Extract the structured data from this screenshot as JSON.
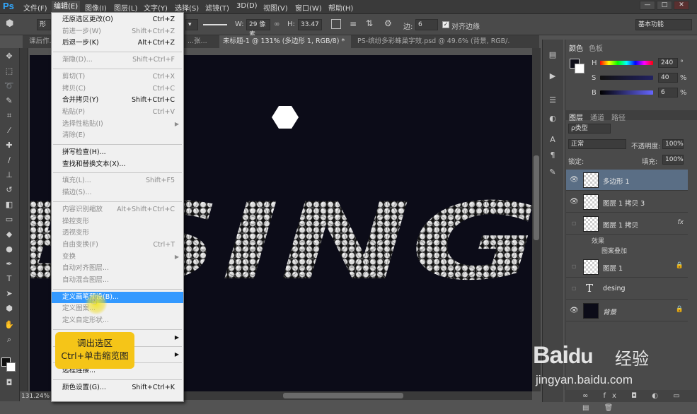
{
  "app": {
    "logo": "Ps"
  },
  "menubar": [
    "文件(F)",
    "编辑(E)",
    "图像(I)",
    "图层(L)",
    "文字(Y)",
    "选择(S)",
    "滤镜(T)",
    "3D(D)",
    "视图(V)",
    "窗口(W)",
    "帮助(H)"
  ],
  "window_buttons": [
    "—",
    "□",
    "✕"
  ],
  "options": {
    "preset": "形",
    "w_label": "W:",
    "w_value": "29 像素",
    "h_label": "H:",
    "h_value": "33.47",
    "sides_label": "边:",
    "sides_value": "6",
    "align_edges": "对齐边缘",
    "workspace": "基本功能"
  },
  "doc_tabs": [
    "课后作...",
    "...张...",
    "未标题-1 @ 131% (多边形 1, RGB/8) *",
    "PS-缤纷多彩蛛巢字效.psd @ 49.6% (背景, RGB/..."
  ],
  "status": {
    "zoom": "131.24%"
  },
  "canvas_text": "ESING",
  "edit_menu": [
    {
      "label": "还原选区更改(O)",
      "shortcut": "Ctrl+Z",
      "disabled": false
    },
    {
      "label": "前进一步(W)",
      "shortcut": "Shift+Ctrl+Z",
      "disabled": true
    },
    {
      "label": "后退一步(K)",
      "shortcut": "Alt+Ctrl+Z",
      "disabled": false
    },
    {
      "sep": true
    },
    {
      "label": "渐隐(D)...",
      "shortcut": "Shift+Ctrl+F",
      "disabled": true
    },
    {
      "sep": true
    },
    {
      "label": "剪切(T)",
      "shortcut": "Ctrl+X",
      "disabled": true
    },
    {
      "label": "拷贝(C)",
      "shortcut": "Ctrl+C",
      "disabled": true
    },
    {
      "label": "合并拷贝(Y)",
      "shortcut": "Shift+Ctrl+C",
      "disabled": false
    },
    {
      "label": "粘贴(P)",
      "shortcut": "Ctrl+V",
      "disabled": true
    },
    {
      "label": "选择性粘贴(I)",
      "shortcut": "",
      "disabled": true,
      "submenu": true
    },
    {
      "label": "清除(E)",
      "shortcut": "",
      "disabled": true
    },
    {
      "sep": true
    },
    {
      "label": "拼写检查(H)...",
      "shortcut": "",
      "disabled": false
    },
    {
      "label": "查找和替换文本(X)...",
      "shortcut": "",
      "disabled": false
    },
    {
      "sep": true
    },
    {
      "label": "填充(L)...",
      "shortcut": "Shift+F5",
      "disabled": true
    },
    {
      "label": "描边(S)...",
      "shortcut": "",
      "disabled": true
    },
    {
      "sep": true
    },
    {
      "label": "内容识别缩放",
      "shortcut": "Alt+Shift+Ctrl+C",
      "disabled": true
    },
    {
      "label": "操控变形",
      "shortcut": "",
      "disabled": true
    },
    {
      "label": "透视变形",
      "shortcut": "",
      "disabled": true
    },
    {
      "label": "自由变换(F)",
      "shortcut": "Ctrl+T",
      "disabled": true
    },
    {
      "label": "变换",
      "shortcut": "",
      "disabled": true,
      "submenu": true
    },
    {
      "label": "自动对齐图层...",
      "shortcut": "",
      "disabled": true
    },
    {
      "label": "自动混合图层...",
      "shortcut": "",
      "disabled": true
    },
    {
      "sep": true
    },
    {
      "label": "定义画笔预设(B)...",
      "shortcut": "",
      "disabled": false,
      "highlight": true
    },
    {
      "label": "定义图案...",
      "shortcut": "",
      "disabled": true
    },
    {
      "label": "定义自定形状...",
      "shortcut": "",
      "disabled": true
    },
    {
      "sep": true
    },
    {
      "label": "",
      "shortcut": "",
      "disabled": false,
      "submenu": true
    },
    {
      "sep": true
    },
    {
      "label": "",
      "shortcut": "",
      "disabled": false,
      "submenu": true
    },
    {
      "sep": true
    },
    {
      "label": "远程连接...",
      "shortcut": "",
      "disabled": false
    },
    {
      "sep": true
    },
    {
      "label": "颜色设置(G)...",
      "shortcut": "Shift+Ctrl+K",
      "disabled": false
    }
  ],
  "callout": {
    "line1": "调出选区",
    "line2": "Ctrl+单击缩览图"
  },
  "color_panel": {
    "tabs": [
      "颜色",
      "色板"
    ],
    "h_label": "H",
    "h_value": "240",
    "h_unit": "°",
    "s_label": "S",
    "s_value": "40",
    "s_unit": "%",
    "b_label": "B",
    "b_value": "6",
    "b_unit": "%"
  },
  "layers_panel": {
    "tabs": [
      "图层",
      "通道",
      "路径"
    ],
    "filter": "ρ类型",
    "blend_mode": "正常",
    "opacity_label": "不透明度:",
    "opacity_value": "100%",
    "lock_label": "锁定:",
    "fill_label": "填充:",
    "fill_value": "100%",
    "fx": "fx",
    "effects_label": "效果",
    "pattern_overlay": "图案叠加",
    "layers": [
      {
        "name": "多边形 1",
        "visible": true,
        "selected": true
      },
      {
        "name": "图层 1 拷贝 3",
        "visible": true
      },
      {
        "name": "图层 1 拷贝",
        "visible": false,
        "fx": true
      },
      {
        "name": "图层 1",
        "visible": false,
        "locked": true
      },
      {
        "name": "desing",
        "visible": false,
        "text": true
      },
      {
        "name": "背景",
        "visible": true,
        "locked": true,
        "background": true
      }
    ]
  },
  "watermark": {
    "logo": "Bai",
    "logo_paw": "du",
    "text": "经验",
    "url": "jingyan.baidu.com"
  }
}
